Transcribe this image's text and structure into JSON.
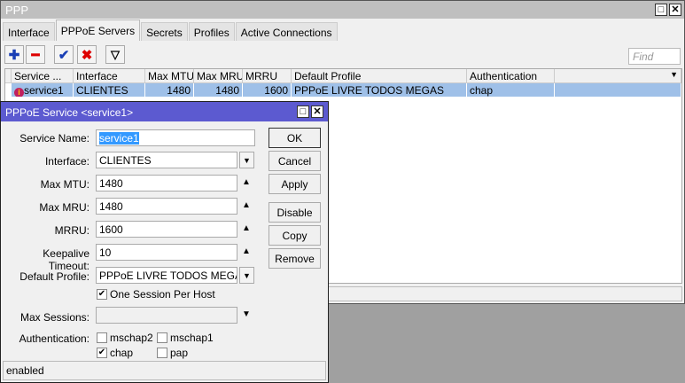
{
  "window": {
    "title": "PPP"
  },
  "tabs": [
    "Interface",
    "PPPoE Servers",
    "Secrets",
    "Profiles",
    "Active Connections"
  ],
  "find_placeholder": "Find",
  "table": {
    "headers": [
      "Service ...",
      "Interface",
      "Max MTU",
      "Max MRU",
      "MRRU",
      "Default Profile",
      "Authentication"
    ],
    "rows": [
      {
        "service": "service1",
        "interface": "CLIENTES",
        "max_mtu": "1480",
        "max_mru": "1480",
        "mrru": "1600",
        "default_profile": "PPPoE LIVRE TODOS MEGAS",
        "authentication": "chap"
      }
    ]
  },
  "dialog": {
    "title": "PPPoE Service <service1>",
    "labels": {
      "service_name": "Service Name:",
      "interface": "Interface:",
      "max_mtu": "Max MTU:",
      "max_mru": "Max MRU:",
      "mrru": "MRRU:",
      "keepalive": "Keepalive Timeout:",
      "default_profile": "Default Profile:",
      "max_sessions": "Max Sessions:",
      "authentication": "Authentication:"
    },
    "values": {
      "service_name": "service1",
      "interface": "CLIENTES",
      "max_mtu": "1480",
      "max_mru": "1480",
      "mrru": "1600",
      "keepalive": "10",
      "default_profile": "PPPoE LIVRE TODOS MEGAS",
      "max_sessions": ""
    },
    "one_session": "One Session Per Host",
    "auth": {
      "mschap2": "mschap2",
      "mschap1": "mschap1",
      "chap": "chap",
      "pap": "pap"
    },
    "buttons": [
      "OK",
      "Cancel",
      "Apply",
      "Disable",
      "Copy",
      "Remove"
    ],
    "status": "enabled"
  }
}
